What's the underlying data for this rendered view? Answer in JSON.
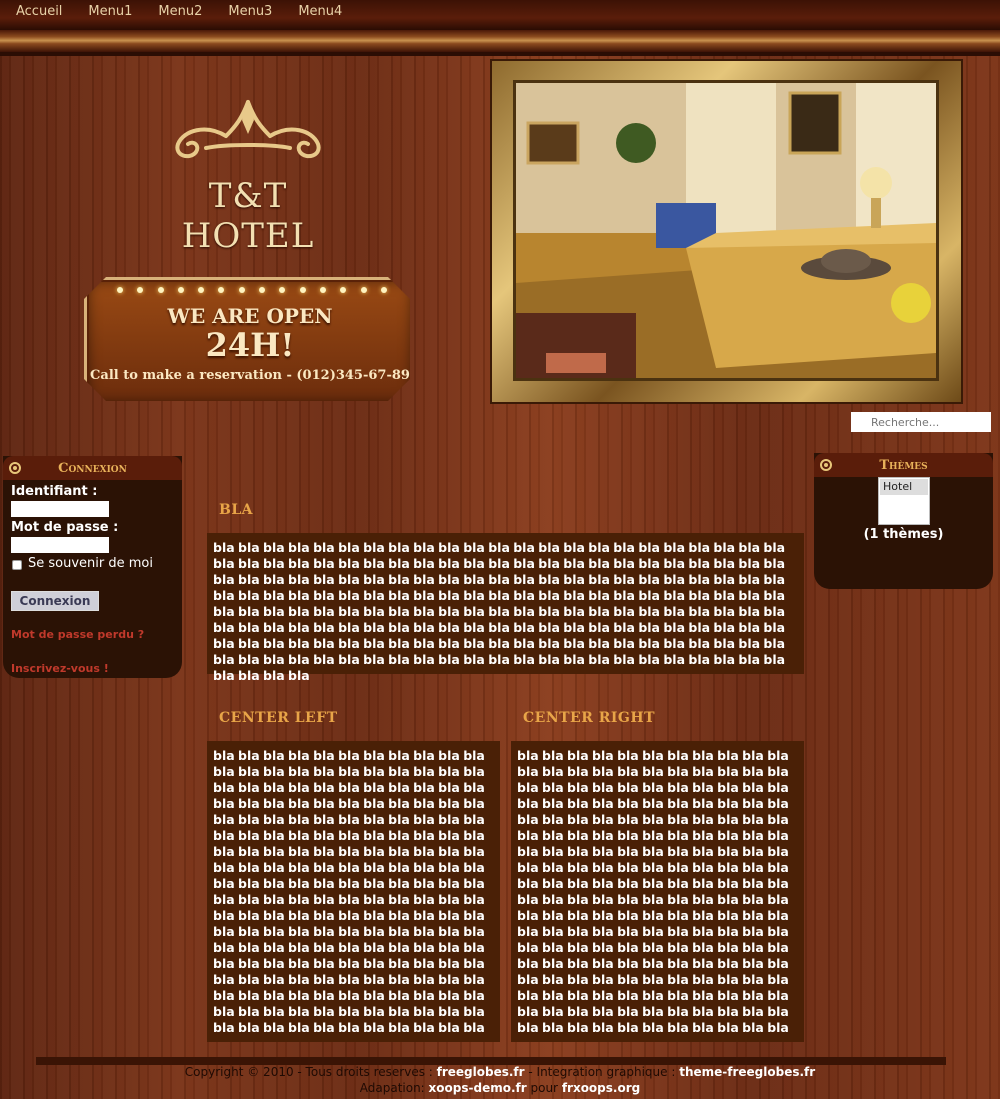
{
  "nav": {
    "items": [
      "Accueil",
      "Menu1",
      "Menu2",
      "Menu3",
      "Menu4"
    ]
  },
  "logo": {
    "text": "T&T HOTEL"
  },
  "sign": {
    "line1": "WE ARE OPEN",
    "line2": "24H!",
    "line3": "Call to make a reservation  - (012)345-67-89"
  },
  "search": {
    "placeholder": "Recherche..."
  },
  "login": {
    "title": "Connexion",
    "username_label": "Identifiant :",
    "password_label": "Mot de passe :",
    "remember_label": "Se souvenir de moi",
    "submit_label": "Connexion",
    "lost_password": "Mot de passe perdu ?",
    "register": "Inscrivez-vous !"
  },
  "themes": {
    "title": "Thèmes",
    "options": [
      "Hotel"
    ],
    "count": "(1 thèmes)"
  },
  "main": {
    "bla_title": "BLA",
    "bla_text": "bla bla bla bla bla bla bla bla bla bla bla bla bla bla bla bla bla bla bla bla bla bla bla bla bla bla bla bla bla bla bla bla bla bla bla bla bla bla bla bla bla bla bla bla bla bla bla bla bla bla bla bla bla bla bla bla bla bla bla bla bla bla bla bla bla bla bla bla bla bla bla bla bla bla bla bla bla bla bla bla bla bla bla bla bla bla bla bla bla bla bla bla bla bla bla bla bla bla bla bla bla bla bla bla bla bla bla bla bla bla bla bla bla bla bla bla bla bla bla bla bla bla bla bla bla bla bla bla bla bla bla bla bla bla bla bla bla bla bla bla bla bla bla bla bla bla bla bla bla bla bla bla bla bla bla bla bla bla bla bla bla bla bla bla bla bla bla bla bla bla bla bla bla bla bla bla bla bla bla bla bla bla bla bla bla bla bla bla",
    "left_title": "CENTER LEFT",
    "left_text": "bla bla bla bla bla bla bla bla bla bla bla bla bla bla bla bla bla bla bla bla bla bla bla bla bla bla bla bla bla bla bla bla bla bla bla bla bla bla bla bla bla bla bla bla bla bla bla bla bla bla bla bla bla bla bla bla bla bla bla bla bla bla bla bla bla bla bla bla bla bla bla bla bla bla bla bla bla bla bla bla bla bla bla bla bla bla bla bla bla bla bla bla bla bla bla bla bla bla bla bla bla bla bla bla bla bla bla bla bla bla bla bla bla bla bla bla bla bla bla bla bla bla bla bla bla bla bla bla bla bla bla bla bla bla bla bla bla bla bla bla bla bla bla bla bla bla bla bla bla bla bla bla bla bla bla bla bla bla bla bla bla bla bla bla bla bla bla bla bla bla bla bla bla bla bla bla bla bla bla bla bla bla bla bla bla bla bla bla bla bla bla bla bla bla bla bla bla bla",
    "right_title": "CENTER RIGHT",
    "right_text": "bla bla bla bla bla bla bla bla bla bla bla bla bla bla bla bla bla bla bla bla bla bla bla bla bla bla bla bla bla bla bla bla bla bla bla bla bla bla bla bla bla bla bla bla bla bla bla bla bla bla bla bla bla bla bla bla bla bla bla bla bla bla bla bla bla bla bla bla bla bla bla bla bla bla bla bla bla bla bla bla bla bla bla bla bla bla bla bla bla bla bla bla bla bla bla bla bla bla bla bla bla bla bla bla bla bla bla bla bla bla bla bla bla bla bla bla bla bla bla bla bla bla bla bla bla bla bla bla bla bla bla bla bla bla bla bla bla bla bla bla bla bla bla bla bla bla bla bla bla bla bla bla bla bla bla bla bla bla bla bla bla bla bla bla bla bla bla bla bla bla bla bla bla bla bla bla bla bla bla bla bla bla bla bla bla bla bla bla bla bla bla bla bla bla bla bla bla bla"
  },
  "footer": {
    "copyright": "Copyright © 2010 - Tous droits reserves : ",
    "site": "freeglobes.fr",
    "integration": " - Integration graphique : ",
    "theme_site": "theme-freeglobes.fr",
    "adaptation": "Adapation: ",
    "xoops_demo": "xoops-demo.fr",
    "pour": " pour ",
    "frxoops": "frxoops.org"
  },
  "colors": {
    "wood": "#7a3317",
    "panel": "#4a2006",
    "accent": "#e8a548",
    "link": "#c0392b"
  }
}
